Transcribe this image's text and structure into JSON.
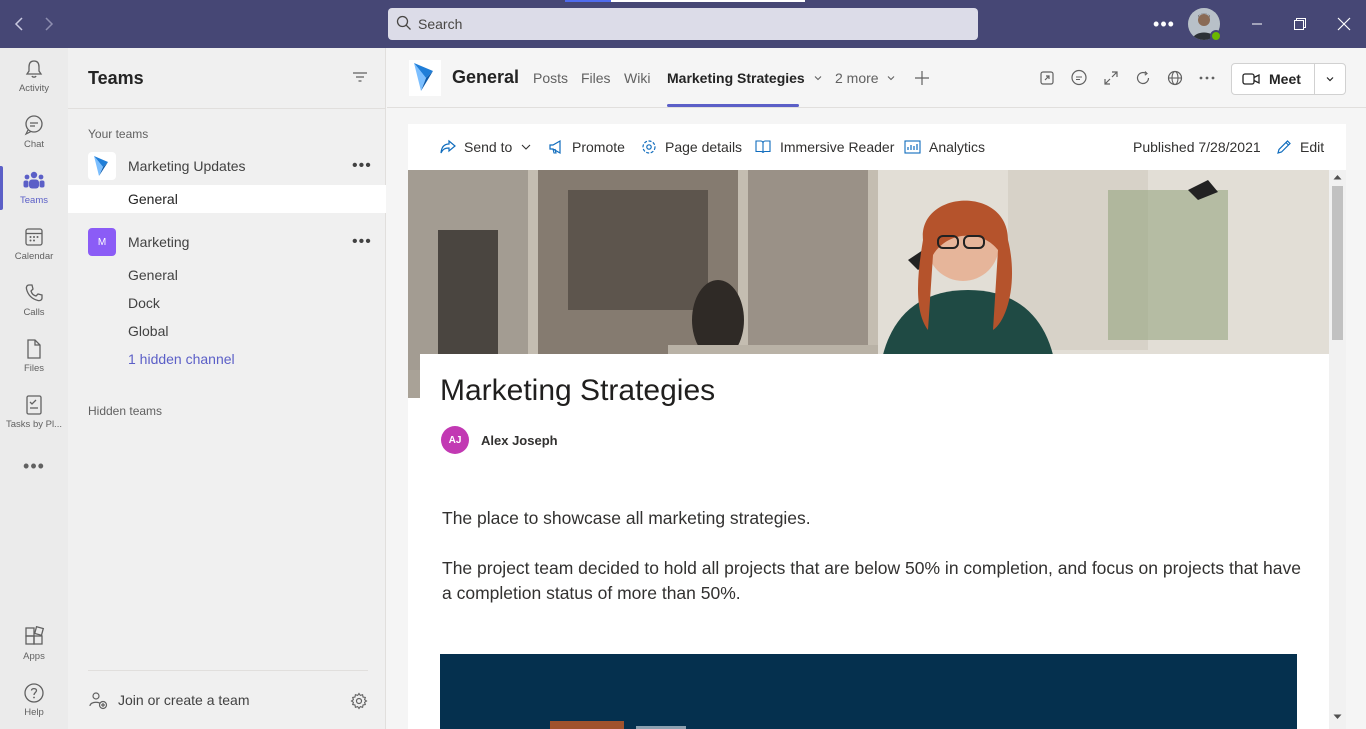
{
  "app": {
    "search_placeholder": "Search",
    "more_options": "•••"
  },
  "rail": {
    "items": [
      {
        "label": "Activity",
        "icon": "bell-icon"
      },
      {
        "label": "Chat",
        "icon": "chat-icon"
      },
      {
        "label": "Teams",
        "icon": "teams-icon"
      },
      {
        "label": "Calendar",
        "icon": "calendar-icon"
      },
      {
        "label": "Calls",
        "icon": "phone-icon"
      },
      {
        "label": "Files",
        "icon": "file-icon"
      },
      {
        "label": "Tasks by Pl...",
        "icon": "tasks-icon"
      }
    ],
    "more": "•••",
    "bottom": [
      {
        "label": "Apps",
        "icon": "apps-icon"
      },
      {
        "label": "Help",
        "icon": "help-icon"
      }
    ]
  },
  "teams_panel": {
    "title": "Teams",
    "your_teams_label": "Your teams",
    "teams": [
      {
        "name": "Marketing Updates",
        "more": "•••",
        "channels": [
          {
            "name": "General",
            "selected": true
          }
        ]
      },
      {
        "name": "Marketing",
        "logo_letter": "M",
        "more": "•••",
        "channels": [
          {
            "name": "General"
          },
          {
            "name": "Dock"
          },
          {
            "name": "Global"
          },
          {
            "name": "1 hidden channel"
          }
        ]
      }
    ],
    "hidden_teams_label": "Hidden teams",
    "join_label": "Join or create a team"
  },
  "channel": {
    "name": "General",
    "tabs": [
      {
        "label": "Posts"
      },
      {
        "label": "Files"
      },
      {
        "label": "Wiki"
      },
      {
        "label": "Marketing Strategies",
        "active": true
      },
      {
        "label": "2 more"
      }
    ],
    "meet_label": "Meet"
  },
  "page": {
    "commands": {
      "send_to": "Send to",
      "promote": "Promote",
      "page_details": "Page details",
      "immersive_reader": "Immersive Reader",
      "analytics": "Analytics",
      "published": "Published 7/28/2021",
      "edit": "Edit"
    },
    "title": "Marketing Strategies",
    "author_initials": "AJ",
    "author_name": "Alex Joseph",
    "paragraph1": "The place to showcase all marketing strategies.",
    "paragraph2": "The project team decided to hold all projects that are below 50% in completion, and focus on projects that have a completion status of more than 50%."
  },
  "colors": {
    "titlebar": "#464775",
    "accent": "#5b5fc7",
    "author_avatar": "#c239b3",
    "banner": "#05304e"
  }
}
